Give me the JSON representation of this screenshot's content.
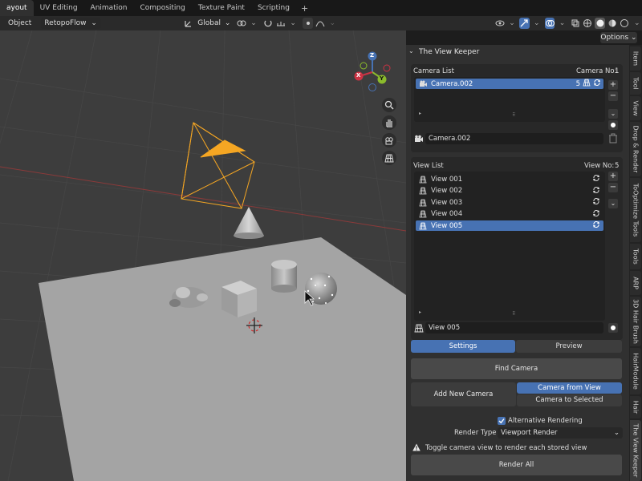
{
  "workspace_tabs": [
    "ayout",
    "UV Editing",
    "Animation",
    "Compositing",
    "Texture Paint",
    "Scripting"
  ],
  "workspace_add": "+",
  "header": {
    "mode": "Object",
    "addon_menu": "RetopoFlow",
    "orientation": "Global",
    "options_label": "Options"
  },
  "gizmo": {
    "x": "X",
    "y": "Y",
    "z": "Z"
  },
  "panel": {
    "title": "The View Keeper",
    "camera_list_label": "Camera List",
    "camera_no_label": "Camera No:",
    "camera_no_value": "1",
    "cameras": [
      {
        "name": "Camera.002",
        "count": "5"
      }
    ],
    "camera_field": "Camera.002",
    "view_list_label": "View List",
    "view_no_label": "View No:",
    "view_no_value": "5",
    "views": [
      "View 001",
      "View 002",
      "View 003",
      "View 004",
      "View 005"
    ],
    "view_field": "View 005",
    "tab_settings": "Settings",
    "tab_preview": "Preview",
    "find_camera": "Find Camera",
    "add_new_camera": "Add New Camera",
    "camera_from_view": "Camera from View",
    "camera_to_selected": "Camera to Selected",
    "alt_rendering_label": "Alternative Rendering",
    "alt_rendering_checked": true,
    "render_type_label": "Render Type",
    "render_type_value": "Viewport Render",
    "warning_text": "Toggle camera view to render each stored view",
    "render_all": "Render All"
  },
  "side_tabs": [
    "Item",
    "Tool",
    "View",
    "Drop & Render",
    "ToOptimize Tools",
    "Tools",
    "ARP",
    "3D Hair Brush",
    "HairModule",
    "Hair",
    "The View Keeper"
  ],
  "colors": {
    "accent": "#4772b3",
    "selection": "#4772b3",
    "camera_wire": "#f5a623"
  }
}
